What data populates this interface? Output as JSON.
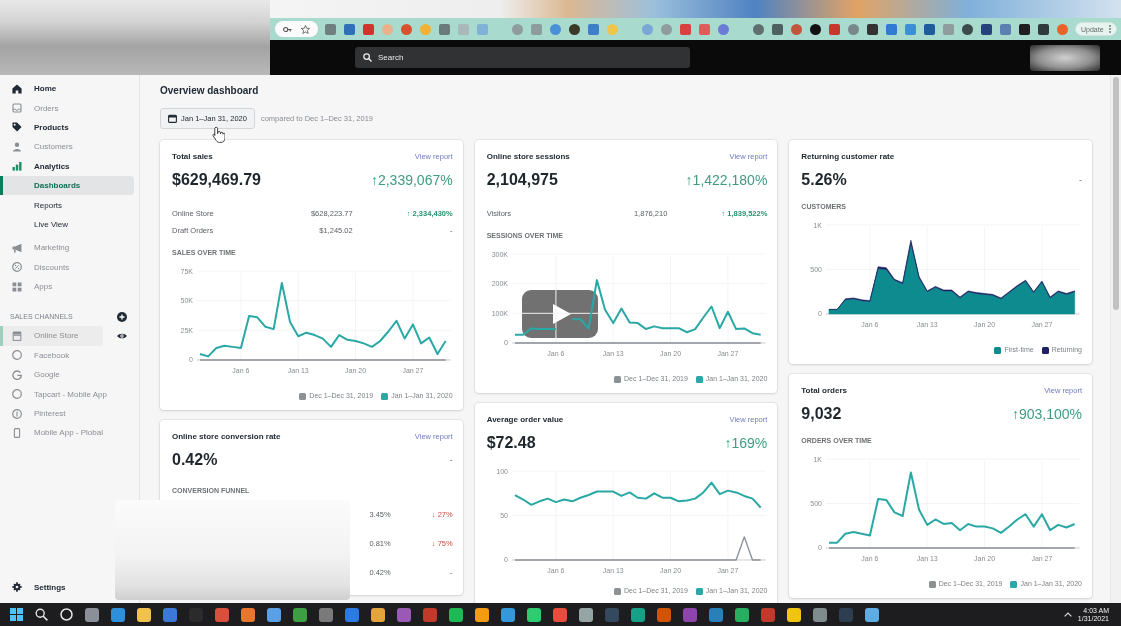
{
  "browser": {
    "update_button": "Update"
  },
  "topbar": {
    "search": {
      "placeholder": "Search"
    }
  },
  "sidebar": {
    "items": [
      {
        "label": "Home",
        "selected": false,
        "disabled": false
      },
      {
        "label": "Orders",
        "selected": false,
        "disabled": true
      },
      {
        "label": "Products",
        "selected": false,
        "disabled": false
      },
      {
        "label": "Customers",
        "selected": false,
        "disabled": true
      },
      {
        "label": "Analytics",
        "selected": false,
        "disabled": false,
        "expanded": true,
        "children": [
          {
            "label": "Dashboards",
            "selected": true
          },
          {
            "label": "Reports",
            "selected": false
          },
          {
            "label": "Live View",
            "selected": false
          }
        ]
      },
      {
        "label": "Marketing",
        "selected": false,
        "disabled": true
      },
      {
        "label": "Discounts",
        "selected": false,
        "disabled": true
      },
      {
        "label": "Apps",
        "selected": false,
        "disabled": true
      }
    ],
    "channels_heading": "SALES CHANNELS",
    "channels": [
      {
        "label": "Online Store",
        "kind": "store",
        "selected": true,
        "disabled": true
      },
      {
        "label": "Facebook",
        "kind": "app",
        "selected": false,
        "disabled": true
      },
      {
        "label": "Google",
        "kind": "app",
        "selected": false,
        "disabled": true
      },
      {
        "label": "Tapcart - Mobile App",
        "kind": "app",
        "selected": false,
        "disabled": true
      },
      {
        "label": "Pinterest",
        "kind": "app",
        "selected": false,
        "disabled": true
      },
      {
        "label": "Mobile App - Plobal",
        "kind": "app",
        "selected": false,
        "disabled": true
      }
    ],
    "settings": "Settings"
  },
  "page": {
    "title": "Overview dashboard",
    "date_range": "Jan 1–Jan 31, 2020",
    "comparison": "compared to Dec 1–Dec 31, 2019"
  },
  "dashboard": {
    "columns": [
      {
        "cards": [
          {
            "title": "Total sales",
            "link": "View report",
            "value": "$629,469.79",
            "change": "↑2,339,067%",
            "increase": true,
            "decrease": false,
            "breakdown": [
              {
                "label": "Online Store",
                "value": "$628,223.77",
                "change": "↑ 2,334,430%",
                "increase": true,
                "decrease": false
              },
              {
                "label": "Draft Orders",
                "value": "$1,245.02",
                "change": "-",
                "increase": false,
                "decrease": false
              }
            ],
            "chart_data": {
              "type": "line",
              "title": "SALES OVER TIME",
              "grid": true,
              "categories": [
                null,
                null,
                null,
                null,
                null,
                "Jan 6",
                null,
                null,
                null,
                null,
                null,
                null,
                "Jan 13",
                null,
                null,
                null,
                null,
                null,
                null,
                "Jan 20",
                null,
                null,
                null,
                null,
                null,
                null,
                "Jan 27",
                null,
                null,
                null,
                null
              ],
              "ylim": [
                0,
                75000
              ],
              "yticks": [
                {
                  "value": 0,
                  "label": "0"
                },
                {
                  "value": 25000,
                  "label": "25K"
                },
                {
                  "value": 50000,
                  "label": "50K"
                },
                {
                  "value": 75000,
                  "label": "75K"
                }
              ],
              "series": [
                {
                  "name": "Dec 1–Dec 31, 2019",
                  "color": "#8c9196",
                  "values": [
                    0,
                    0,
                    0,
                    0,
                    0,
                    0,
                    0,
                    0,
                    0,
                    0,
                    0,
                    0,
                    0,
                    0,
                    0,
                    0,
                    0,
                    0,
                    0,
                    0,
                    0,
                    0,
                    0,
                    0,
                    0,
                    0,
                    0,
                    0,
                    0,
                    0,
                    0
                  ]
                },
                {
                  "name": "Jan 1–Jan 31, 2020",
                  "color": "#2aa8a6",
                  "values": [
                    5000,
                    3000,
                    10000,
                    12000,
                    11000,
                    10000,
                    37000,
                    36000,
                    28000,
                    26000,
                    65000,
                    32000,
                    20000,
                    23000,
                    21000,
                    18000,
                    11000,
                    21000,
                    17000,
                    16000,
                    14000,
                    11000,
                    16000,
                    24000,
                    33000,
                    18000,
                    30000,
                    14000,
                    19000,
                    5000,
                    16000
                  ]
                }
              ]
            }
          },
          {
            "title": "Online store conversion rate",
            "link": "View report",
            "value": "0.42%",
            "change": "-",
            "increase": false,
            "decrease": false,
            "funnel": {
              "title": "CONVERSION FUNNEL",
              "rows": [
                {
                  "value": "3.45%",
                  "change": "↓ 27%",
                  "increase": false,
                  "decrease": true
                },
                {
                  "value": "0.81%",
                  "change": "↓ 75%",
                  "increase": false,
                  "decrease": true
                },
                {
                  "value": "0.42%",
                  "change": "-",
                  "increase": false,
                  "decrease": false
                }
              ]
            }
          }
        ]
      },
      {
        "cards": [
          {
            "title": "Online store sessions",
            "link": "View report",
            "value": "2,104,975",
            "change": "↑1,422,180%",
            "increase": true,
            "decrease": false,
            "breakdown": [
              {
                "label": "Visitors",
                "value": "1,876,210",
                "change": "↑ 1,839,522%",
                "increase": true,
                "decrease": false
              }
            ],
            "chart_data": {
              "type": "line",
              "title": "SESSIONS OVER TIME",
              "grid": true,
              "categories": [
                null,
                null,
                null,
                null,
                null,
                "Jan 6",
                null,
                null,
                null,
                null,
                null,
                null,
                "Jan 13",
                null,
                null,
                null,
                null,
                null,
                null,
                "Jan 20",
                null,
                null,
                null,
                null,
                null,
                null,
                "Jan 27",
                null,
                null,
                null,
                null
              ],
              "ylim": [
                0,
                300000
              ],
              "yticks": [
                {
                  "value": 0,
                  "label": "0"
                },
                {
                  "value": 100000,
                  "label": "100K"
                },
                {
                  "value": 200000,
                  "label": "200K"
                },
                {
                  "value": 300000,
                  "label": "300K"
                }
              ],
              "series": [
                {
                  "name": "Dec 1–Dec 31, 2019",
                  "color": "#8c9196",
                  "values": [
                    0,
                    0,
                    0,
                    0,
                    0,
                    0,
                    0,
                    0,
                    0,
                    0,
                    0,
                    0,
                    0,
                    0,
                    0,
                    0,
                    0,
                    0,
                    0,
                    0,
                    0,
                    0,
                    0,
                    0,
                    0,
                    0,
                    0,
                    0,
                    0,
                    0,
                    0
                  ]
                },
                {
                  "name": "Jan 1–Jan 31, 2020",
                  "color": "#2aa8a6",
                  "values": [
                    28000,
                    28000,
                    49000,
                    47000,
                    47000,
                    47000,
                    null,
                    80000,
                    80000,
                    49000,
                    212000,
                    112000,
                    67000,
                    116000,
                    69000,
                    67000,
                    47000,
                    56000,
                    50000,
                    50000,
                    50000,
                    36000,
                    47000,
                    86000,
                    123000,
                    50000,
                    105000,
                    47000,
                    49000,
                    33000,
                    28000
                  ]
                }
              ]
            }
          },
          {
            "title": "Average order value",
            "link": "View report",
            "value": "$72.48",
            "change": "↑169%",
            "increase": true,
            "decrease": false,
            "chart_data": {
              "type": "line",
              "grid": true,
              "categories": [
                null,
                null,
                null,
                null,
                null,
                "Jan 6",
                null,
                null,
                null,
                null,
                null,
                null,
                "Jan 13",
                null,
                null,
                null,
                null,
                null,
                null,
                "Jan 20",
                null,
                null,
                null,
                null,
                null,
                null,
                "Jan 27",
                null,
                null,
                null,
                null
              ],
              "ylim": [
                0,
                100
              ],
              "yticks": [
                {
                  "value": 0,
                  "label": "0"
                },
                {
                  "value": 50,
                  "label": "50"
                },
                {
                  "value": 100,
                  "label": "100"
                }
              ],
              "series": [
                {
                  "name": "Dec 1–Dec 31, 2019",
                  "color": "#8c9196",
                  "values": [
                    0,
                    0,
                    0,
                    0,
                    0,
                    0,
                    0,
                    0,
                    0,
                    0,
                    0,
                    0,
                    0,
                    0,
                    0,
                    0,
                    0,
                    0,
                    0,
                    0,
                    0,
                    0,
                    0,
                    0,
                    0,
                    0,
                    0,
                    0,
                    26,
                    0,
                    0
                  ]
                },
                {
                  "name": "Jan 1–Jan 31, 2020",
                  "color": "#2aa8a6",
                  "values": [
                    73,
                    68,
                    62,
                    66,
                    69,
                    65,
                    68,
                    66,
                    70,
                    73,
                    77,
                    77,
                    77,
                    72,
                    76,
                    70,
                    69,
                    75,
                    70,
                    70,
                    66,
                    67,
                    69,
                    76,
                    87,
                    74,
                    78,
                    76,
                    72,
                    69,
                    59
                  ]
                }
              ]
            }
          }
        ]
      },
      {
        "cards": [
          {
            "title": "Returning customer rate",
            "value": "5.26%",
            "change": "-",
            "increase": false,
            "decrease": false,
            "chart_data": {
              "type": "area",
              "stacked": true,
              "title": "CUSTOMERS",
              "grid": true,
              "categories": [
                null,
                null,
                null,
                null,
                null,
                "Jan 6",
                null,
                null,
                null,
                null,
                null,
                null,
                "Jan 13",
                null,
                null,
                null,
                null,
                null,
                null,
                "Jan 20",
                null,
                null,
                null,
                null,
                null,
                null,
                "Jan 27",
                null,
                null,
                null,
                null
              ],
              "ylim": [
                0,
                1000
              ],
              "yticks": [
                {
                  "value": 0,
                  "label": "0"
                },
                {
                  "value": 500,
                  "label": "500"
                },
                {
                  "value": 1000,
                  "label": "1K"
                }
              ],
              "series": [
                {
                  "name": "First-time",
                  "color": "#0e8b8f",
                  "values": [
                    50,
                    50,
                    160,
                    170,
                    150,
                    140,
                    510,
                    500,
                    380,
                    340,
                    800,
                    410,
                    250,
                    300,
                    260,
                    260,
                    180,
                    250,
                    230,
                    220,
                    210,
                    170,
                    240,
                    310,
                    370,
                    240,
                    360,
                    180,
                    250,
                    220,
                    250
                  ]
                },
                {
                  "name": "Returning",
                  "color": "#1d2163",
                  "values": [
                    0,
                    0,
                    10,
                    10,
                    10,
                    10,
                    20,
                    20,
                    10,
                    10,
                    30,
                    10,
                    10,
                    10,
                    10,
                    10,
                    10,
                    10,
                    10,
                    10,
                    10,
                    10,
                    10,
                    10,
                    10,
                    10,
                    10,
                    10,
                    10,
                    10,
                    10
                  ]
                }
              ]
            }
          },
          {
            "title": "Total orders",
            "link": "View report",
            "value": "9,032",
            "change": "↑903,100%",
            "increase": true,
            "decrease": false,
            "chart_data": {
              "type": "line",
              "title": "ORDERS OVER TIME",
              "grid": true,
              "categories": [
                null,
                null,
                null,
                null,
                null,
                "Jan 6",
                null,
                null,
                null,
                null,
                null,
                null,
                "Jan 13",
                null,
                null,
                null,
                null,
                null,
                null,
                "Jan 20",
                null,
                null,
                null,
                null,
                null,
                null,
                "Jan 27",
                null,
                null,
                null,
                null
              ],
              "ylim": [
                0,
                1000
              ],
              "yticks": [
                {
                  "value": 0,
                  "label": "0"
                },
                {
                  "value": 500,
                  "label": "500"
                },
                {
                  "value": 1000,
                  "label": "1K"
                }
              ],
              "series": [
                {
                  "name": "Dec 1–Dec 31, 2019",
                  "color": "#8c9196",
                  "values": [
                    0,
                    0,
                    0,
                    0,
                    0,
                    0,
                    0,
                    0,
                    0,
                    0,
                    0,
                    0,
                    0,
                    0,
                    0,
                    0,
                    0,
                    0,
                    0,
                    0,
                    0,
                    0,
                    0,
                    0,
                    0,
                    0,
                    0,
                    0,
                    0,
                    0,
                    0
                  ]
                },
                {
                  "name": "Jan 1–Jan 31, 2020",
                  "color": "#2aa8a6",
                  "values": [
                    60,
                    60,
                    160,
                    180,
                    160,
                    140,
                    550,
                    540,
                    400,
                    360,
                    850,
                    430,
                    260,
                    320,
                    270,
                    280,
                    200,
                    270,
                    240,
                    240,
                    220,
                    170,
                    240,
                    320,
                    380,
                    240,
                    380,
                    200,
                    260,
                    230,
                    270
                  ]
                }
              ]
            }
          }
        ]
      }
    ]
  },
  "taskbar": {
    "time": "4:03 AM",
    "date": "1/31/2021"
  }
}
